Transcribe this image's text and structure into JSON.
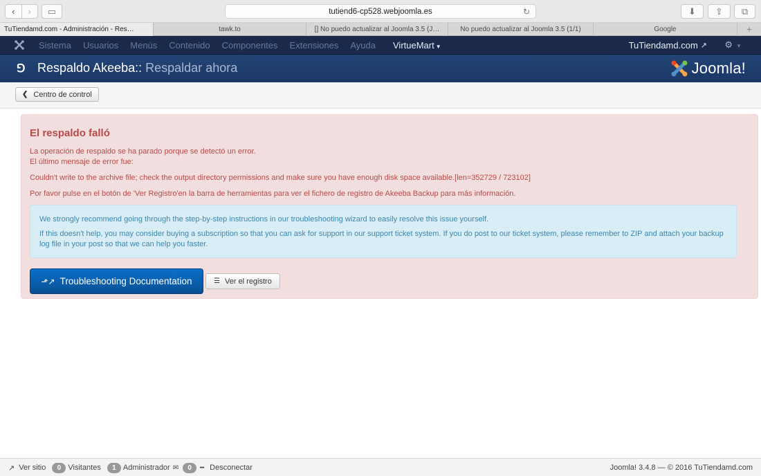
{
  "browser": {
    "url": "tutiend6-cp528.webjoomla.es",
    "tabs": [
      "TuTiendamd.com - Administración - Res…",
      "tawk.to",
      "[] No puedo actualizar al Joomla 3.5 (J…",
      "No puedo actualizar al Joomla 3.5 (1/1)",
      "Google"
    ]
  },
  "menubar": {
    "items": [
      "Sistema",
      "Usuarios",
      "Menús",
      "Contenido",
      "Componentes",
      "Extensiones",
      "Ayuda"
    ],
    "virtuemart": "VirtueMart",
    "site": "TuTiendamd.com"
  },
  "header": {
    "title": "Respaldo Akeeba::",
    "subtitle": "Respaldar ahora",
    "brand": "Joomla!"
  },
  "subhead": {
    "back_label": "Centro de control"
  },
  "alert": {
    "heading": "El respaldo falló",
    "line1": "La operación de respaldo se ha parado porque se detectó un error.",
    "line2": "El último mensaje de error fue:",
    "error": "Couldn't write to the archive file; check the output directory permissions and make sure you have enough disk space available.[len=352729 / 723102]",
    "hint": "Por favor pulse en el botón de 'Ver Registro'en la barra de herramientas para ver el fichero de registro de Akeeba Backup para más información.",
    "info1": "We strongly recommend going through the step-by-step instructions in our troubleshooting wizard to easily resolve this issue yourself.",
    "info2": "If this doesn't help, you may consider buying a subscription so that you can ask for support in our support ticket system. If you do post to our ticket system, please remember to ZIP and attach your backup log file in your post so that we can help you faster.",
    "doc_button": "Troubleshooting Documentation",
    "log_button": "Ver el registro"
  },
  "status": {
    "view_site": "Ver sitio",
    "visitors_count": "0",
    "visitors_label": "Visitantes",
    "admin_count": "1",
    "admin_label": "Administrador",
    "msg_count": "0",
    "logout": "Desconectar",
    "footer": "Joomla! 3.4.8  —  © 2016 TuTiendamd.com"
  },
  "colors": {
    "menubar": "#1b2a4a",
    "header": "#1e3c6e",
    "alert_bg": "#f2dede",
    "alert_text": "#b94a48",
    "info_bg": "#d9edf7",
    "primary_button": "#0a5fab"
  }
}
